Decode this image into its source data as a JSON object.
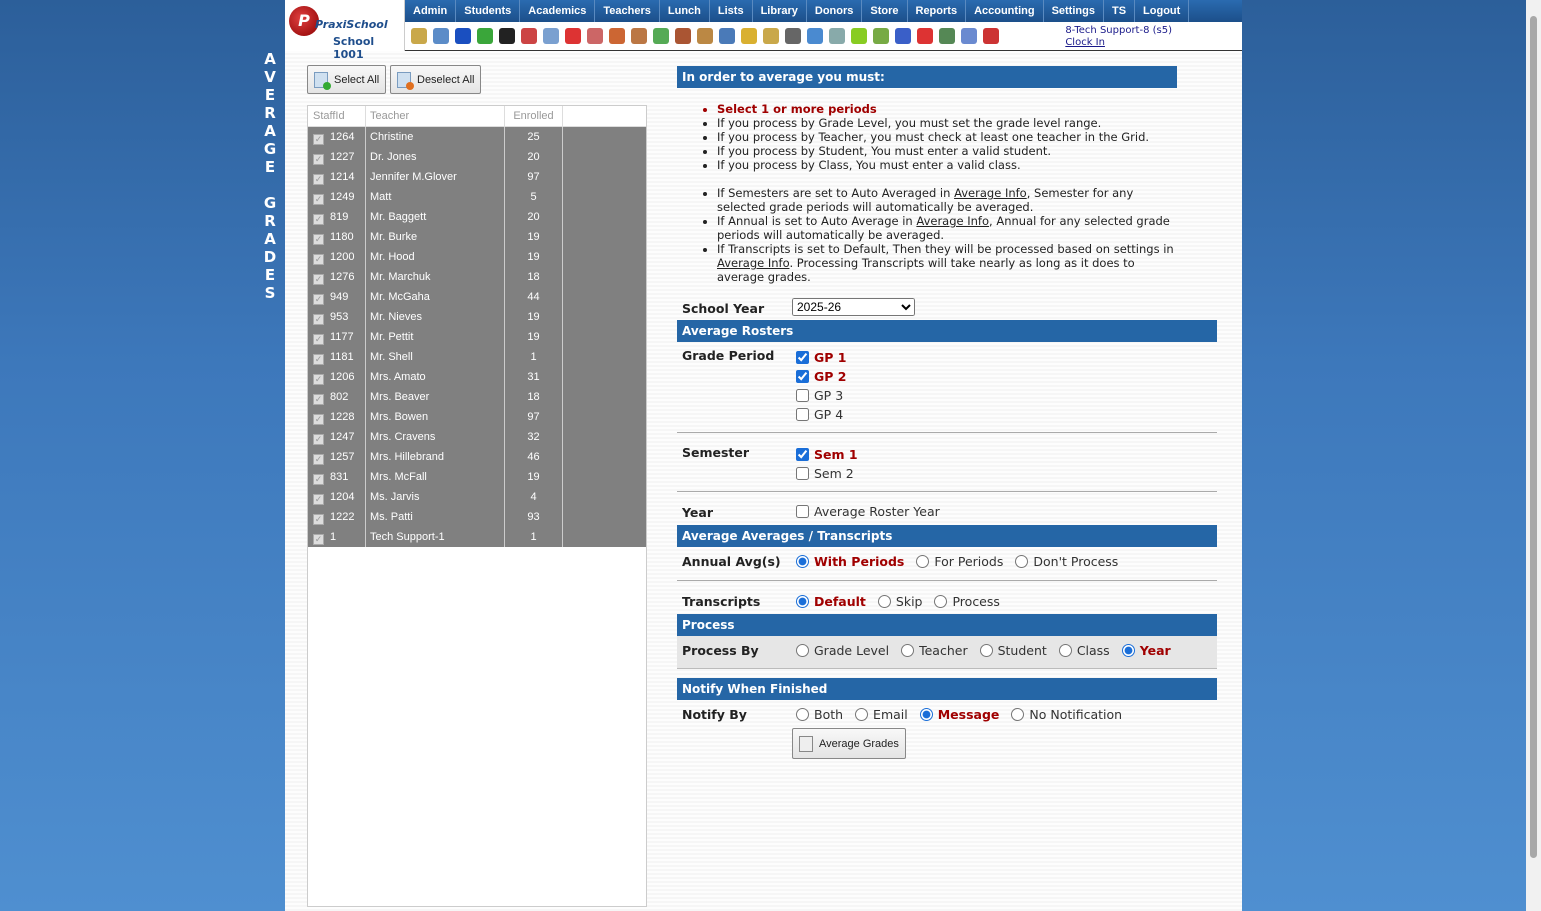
{
  "page_label": "AVERAGE GRADES",
  "logo": {
    "brand": "PraxiSchool",
    "school": "School 1001"
  },
  "menu": [
    "Admin",
    "Students",
    "Academics",
    "Teachers",
    "Lunch",
    "Lists",
    "Library",
    "Donors",
    "Store",
    "Reports",
    "Accounting",
    "Settings",
    "TS",
    "Logout"
  ],
  "toolbar_icons": [
    "search-icon",
    "calendar-grid-icon",
    "email-icon",
    "chat-icon",
    "mobile-icon",
    "speaker-icon",
    "calculator-icon",
    "calendar-icon",
    "megaphone-icon",
    "add-user-icon",
    "user-icon",
    "money-icon",
    "family-icon",
    "lunch-icon",
    "book-icon",
    "tag-icon",
    "export-icon",
    "staff-icon",
    "clock-icon",
    "document-icon",
    "card-icon",
    "printer-icon",
    "ap-icon",
    "pdf-icon",
    "cash-register-icon",
    "help-icon",
    "power-icon"
  ],
  "user": {
    "name": "8-Tech Support-8 (s5)",
    "clock_in": "Clock In"
  },
  "buttons": {
    "select_all": "Select All",
    "deselect_all": "Deselect All",
    "average_grades": "Average Grades"
  },
  "grid": {
    "headers": [
      "StaffId",
      "Teacher",
      "Enrolled"
    ],
    "rows": [
      [
        "1264",
        "Christine",
        "25"
      ],
      [
        "1227",
        "Dr. Jones",
        "20"
      ],
      [
        "1214",
        "Jennifer M.Glover",
        "97"
      ],
      [
        "1249",
        "Matt",
        "5"
      ],
      [
        "819",
        "Mr. Baggett",
        "20"
      ],
      [
        "1180",
        "Mr. Burke",
        "19"
      ],
      [
        "1200",
        "Mr. Hood",
        "19"
      ],
      [
        "1276",
        "Mr. Marchuk",
        "18"
      ],
      [
        "949",
        "Mr. McGaha",
        "44"
      ],
      [
        "953",
        "Mr. Nieves",
        "19"
      ],
      [
        "1177",
        "Mr. Pettit",
        "19"
      ],
      [
        "1181",
        "Mr. Shell",
        "1"
      ],
      [
        "1206",
        "Mrs. Amato",
        "31"
      ],
      [
        "802",
        "Mrs. Beaver",
        "18"
      ],
      [
        "1228",
        "Mrs. Bowen",
        "97"
      ],
      [
        "1247",
        "Mrs. Cravens",
        "32"
      ],
      [
        "1257",
        "Mrs. Hillebrand",
        "46"
      ],
      [
        "831",
        "Mrs. McFall",
        "19"
      ],
      [
        "1204",
        "Ms. Jarvis",
        "4"
      ],
      [
        "1222",
        "Ms. Patti",
        "93"
      ],
      [
        "1",
        "Tech Support-1",
        "1"
      ]
    ]
  },
  "info": {
    "title": "In order to average you must:",
    "req": "Select 1 or more periods",
    "items": [
      "If you process by Grade Level, you must set the grade level range.",
      "If you process by Teacher, you must check at least one teacher in the Grid.",
      "If you process by Student, You must enter a valid student.",
      "If you process by Class, You must enter a valid class."
    ],
    "link": "Average Info",
    "n1a": "If Semesters are set to Auto Averaged in ",
    "n1b": ", Semester for any selected grade periods will automatically be averaged.",
    "n2a": "If Annual is set to Auto Average in ",
    "n2b": ", Annual for any selected grade periods will automatically be averaged.",
    "n3a": "If Transcripts is set to Default, Then they will be processed based on settings in ",
    "n3b": ". Processing Transcripts will take nearly as long as it does to average grades."
  },
  "form": {
    "school_year_label": "School Year",
    "school_year": "2025-26",
    "avg_rosters": "Average Rosters",
    "grade_period_label": "Grade Period",
    "grade_periods": [
      {
        "label": "GP 1",
        "checked": true
      },
      {
        "label": "GP 2",
        "checked": true
      },
      {
        "label": "GP 3",
        "checked": false
      },
      {
        "label": "GP 4",
        "checked": false
      }
    ],
    "semester_label": "Semester",
    "semesters": [
      {
        "label": "Sem 1",
        "checked": true
      },
      {
        "label": "Sem 2",
        "checked": false
      }
    ],
    "year_label": "Year",
    "year_option": "Average Roster Year",
    "avg_avgs": "Average Averages / Transcripts",
    "annual_label": "Annual Avg(s)",
    "annual": [
      "With Periods",
      "For Periods",
      "Don't Process"
    ],
    "annual_selected": 0,
    "transcripts_label": "Transcripts",
    "transcripts": [
      "Default",
      "Skip",
      "Process"
    ],
    "transcripts_selected": 0,
    "process": "Process",
    "process_by_label": "Process By",
    "process_by": [
      "Grade Level",
      "Teacher",
      "Student",
      "Class",
      "Year"
    ],
    "process_by_selected": 4,
    "notify": "Notify When Finished",
    "notify_by_label": "Notify By",
    "notify_by": [
      "Both",
      "Email",
      "Message",
      "No Notification"
    ],
    "notify_selected": 2
  },
  "colors": {
    "header_blue": "#2566a6",
    "required_red": "#a00000"
  }
}
